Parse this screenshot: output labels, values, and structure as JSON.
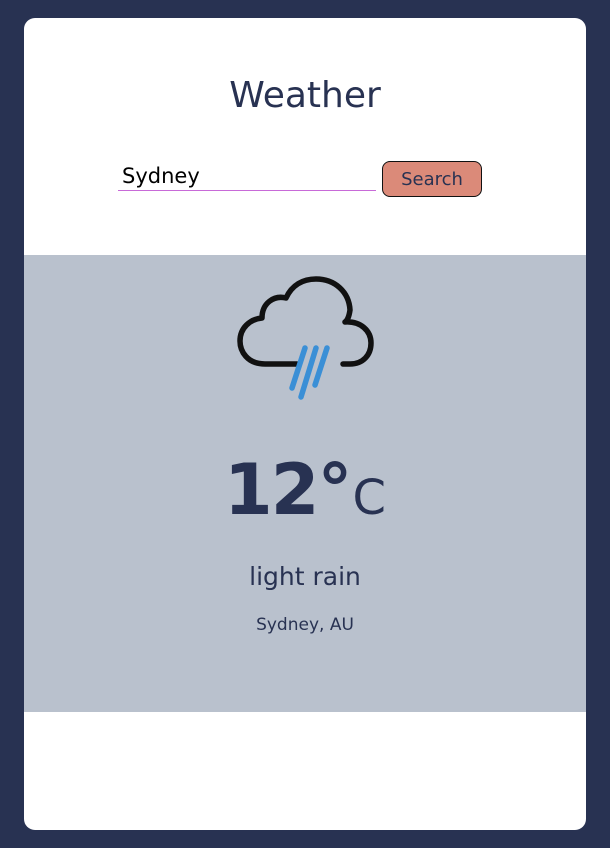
{
  "app": {
    "title": "Weather"
  },
  "search": {
    "value": "Sydney",
    "button_label": "Search"
  },
  "weather": {
    "icon": "rain-cloud-icon",
    "temperature": "12°",
    "unit": "C",
    "description": "light rain",
    "location": "Sydney, AU"
  },
  "colors": {
    "page_background": "#283252",
    "card_background": "#ffffff",
    "panel_background": "#b9c1cd",
    "text": "#283252",
    "button_background": "#db8a79",
    "input_underline": "#c86ad8",
    "rain": "#3a8fd6"
  }
}
